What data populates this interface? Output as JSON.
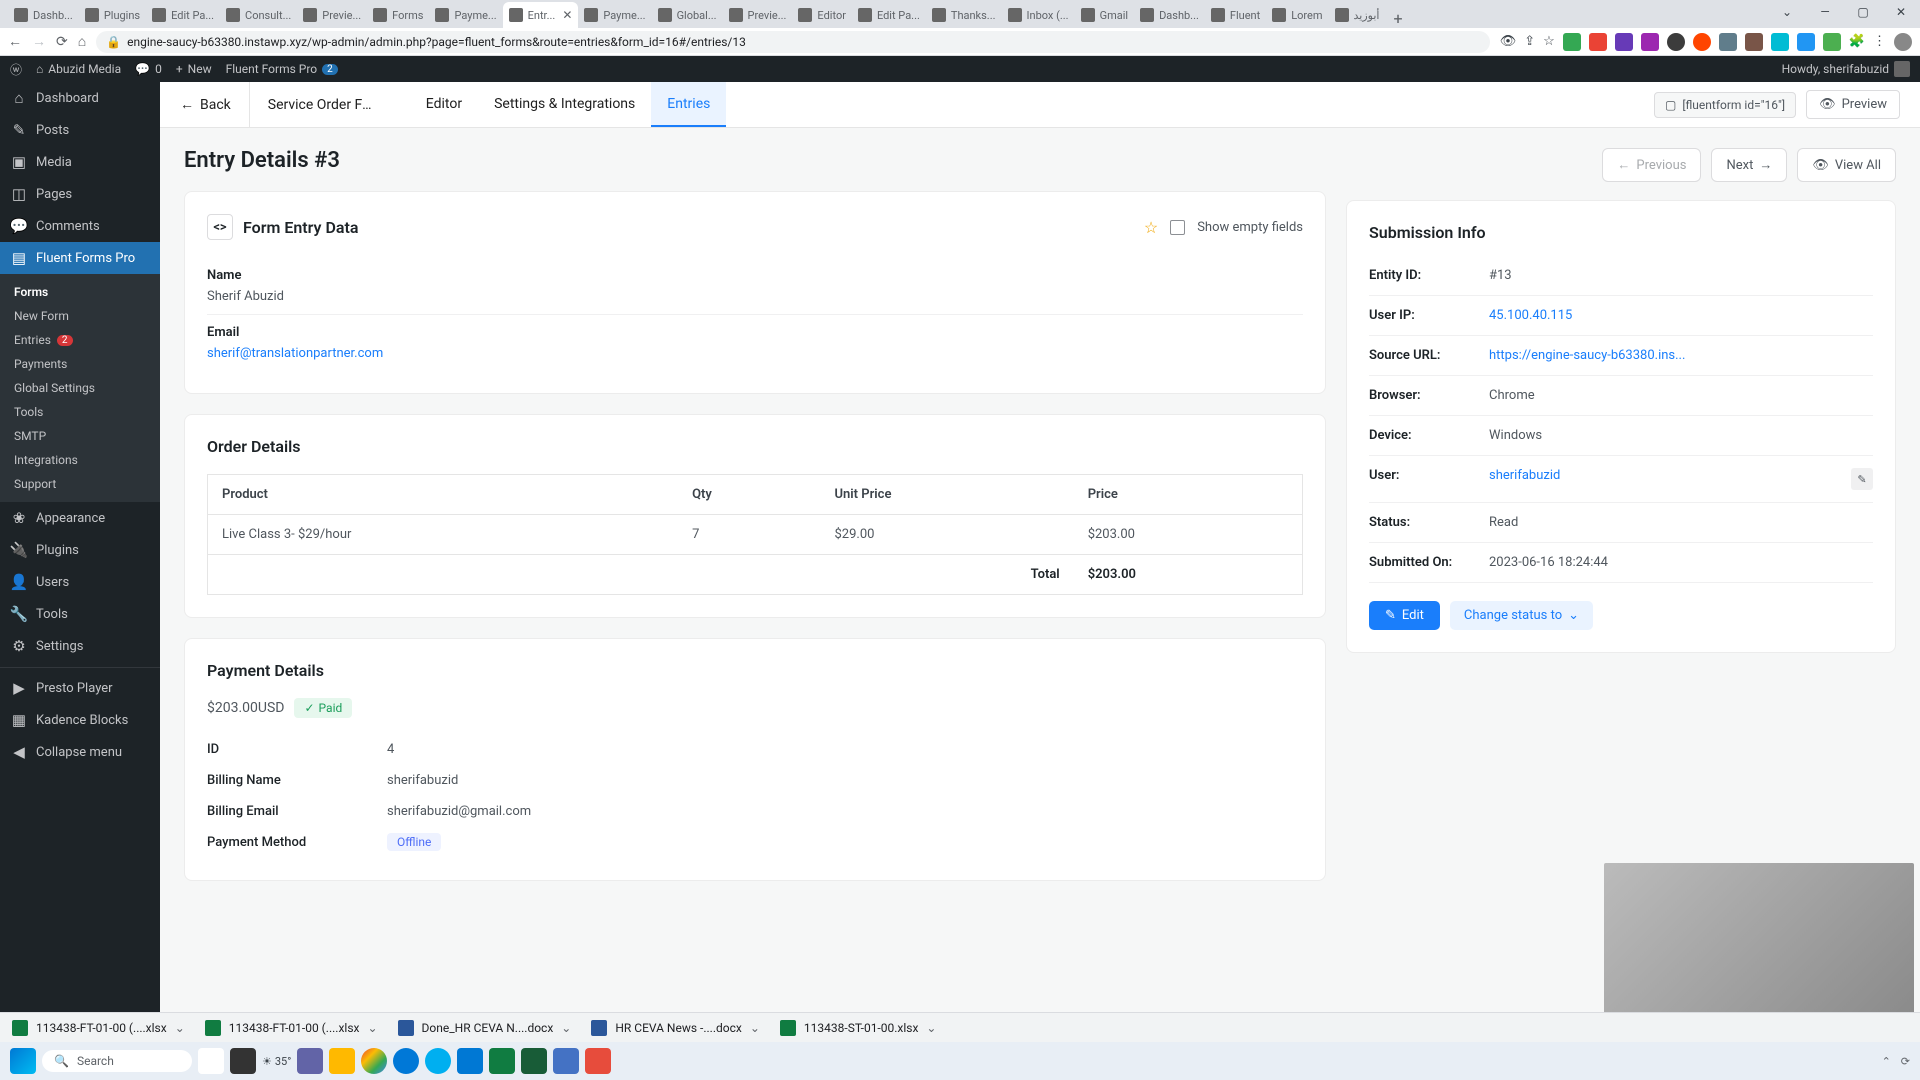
{
  "browser": {
    "url": "engine-saucy-b63380.instawp.xyz/wp-admin/admin.php?page=fluent_forms&route=entries&form_id=16#/entries/13",
    "tabs": [
      "Dashb...",
      "Plugins",
      "Edit Pa...",
      "Consult...",
      "Previe...",
      "Forms",
      "Payme...",
      "Entr...",
      "Payme...",
      "Global...",
      "Previe...",
      "Editor",
      "Edit Pa...",
      "Thanks...",
      "Inbox (...",
      "Gmail",
      "Dashb...",
      "Fluent",
      "Lorem",
      "أبوزيد"
    ],
    "active_tab_index": 7
  },
  "adminbar": {
    "site": "Abuzid Media",
    "comments": "0",
    "new": "New",
    "plugin": "Fluent Forms Pro",
    "plugin_count": "2",
    "howdy": "Howdy, sherifabuzid"
  },
  "sidebar": {
    "items": [
      {
        "icon": "⌂",
        "label": "Dashboard"
      },
      {
        "icon": "✎",
        "label": "Posts"
      },
      {
        "icon": "▣",
        "label": "Media"
      },
      {
        "icon": "◫",
        "label": "Pages"
      },
      {
        "icon": "💬",
        "label": "Comments"
      },
      {
        "icon": "▤",
        "label": "Fluent Forms Pro",
        "active": true
      },
      {
        "icon": "❀",
        "label": "Appearance"
      },
      {
        "icon": "🔌",
        "label": "Plugins"
      },
      {
        "icon": "👤",
        "label": "Users"
      },
      {
        "icon": "🔧",
        "label": "Tools"
      },
      {
        "icon": "⚙",
        "label": "Settings"
      },
      {
        "icon": "▶",
        "label": "Presto Player"
      },
      {
        "icon": "▦",
        "label": "Kadence Blocks"
      },
      {
        "icon": "◀",
        "label": "Collapse menu"
      }
    ],
    "submenu": [
      {
        "label": "Forms",
        "active": true
      },
      {
        "label": "New Form"
      },
      {
        "label": "Entries",
        "badge": "2"
      },
      {
        "label": "Payments"
      },
      {
        "label": "Global Settings"
      },
      {
        "label": "Tools"
      },
      {
        "label": "SMTP"
      },
      {
        "label": "Integrations"
      },
      {
        "label": "Support"
      }
    ]
  },
  "topnav": {
    "back": "Back",
    "form_name": "Service Order For...",
    "tabs": [
      "Editor",
      "Settings & Integrations",
      "Entries"
    ],
    "active_tab": 2,
    "shortcode": "[fluentform id=\"16\"]",
    "preview": "Preview"
  },
  "page": {
    "title": "Entry Details #3",
    "previous": "Previous",
    "next": "Next",
    "view_all": "View All"
  },
  "form_entry": {
    "title": "Form Entry Data",
    "show_empty": "Show empty fields",
    "name_label": "Name",
    "name_value": "Sherif Abuzid",
    "email_label": "Email",
    "email_value": "sherif@translationpartner.com"
  },
  "order": {
    "title": "Order Details",
    "cols": [
      "Product",
      "Qty",
      "Unit Price",
      "Price"
    ],
    "rows": [
      {
        "product": "Live Class 3- $29/hour",
        "qty": "7",
        "unit": "$29.00",
        "price": "$203.00"
      }
    ],
    "total_label": "Total",
    "total_value": "$203.00"
  },
  "payment": {
    "title": "Payment Details",
    "amount": "$203.00USD",
    "status": "Paid",
    "rows": [
      {
        "label": "ID",
        "value": "4"
      },
      {
        "label": "Billing Name",
        "value": "sherifabuzid"
      },
      {
        "label": "Billing Email",
        "value": "sherifabuzid@gmail.com"
      }
    ],
    "method_label": "Payment Method",
    "method_value": "Offline"
  },
  "submission": {
    "title": "Submission Info",
    "rows": [
      {
        "label": "Entity ID:",
        "value": "#13"
      },
      {
        "label": "User IP:",
        "value": "45.100.40.115",
        "link": true
      },
      {
        "label": "Source URL:",
        "value": "https://engine-saucy-b63380.ins...",
        "link": true
      },
      {
        "label": "Browser:",
        "value": "Chrome"
      },
      {
        "label": "Device:",
        "value": "Windows"
      },
      {
        "label": "User:",
        "value": "sherifabuzid",
        "link": true,
        "edit": true
      },
      {
        "label": "Status:",
        "value": "Read"
      },
      {
        "label": "Submitted On:",
        "value": "2023-06-16 18:24:44"
      }
    ],
    "edit": "Edit",
    "change_status": "Change status to"
  },
  "downloads": [
    {
      "name": "113438-FT-01-00 (....xlsx",
      "type": "excel"
    },
    {
      "name": "113438-FT-01-00 (....xlsx",
      "type": "excel"
    },
    {
      "name": "Done_HR CEVA N....docx",
      "type": "word"
    },
    {
      "name": "HR CEVA News -....docx",
      "type": "word"
    },
    {
      "name": "113438-ST-01-00.xlsx",
      "type": "excel"
    }
  ],
  "taskbar": {
    "search": "Search",
    "weather": "35°"
  }
}
